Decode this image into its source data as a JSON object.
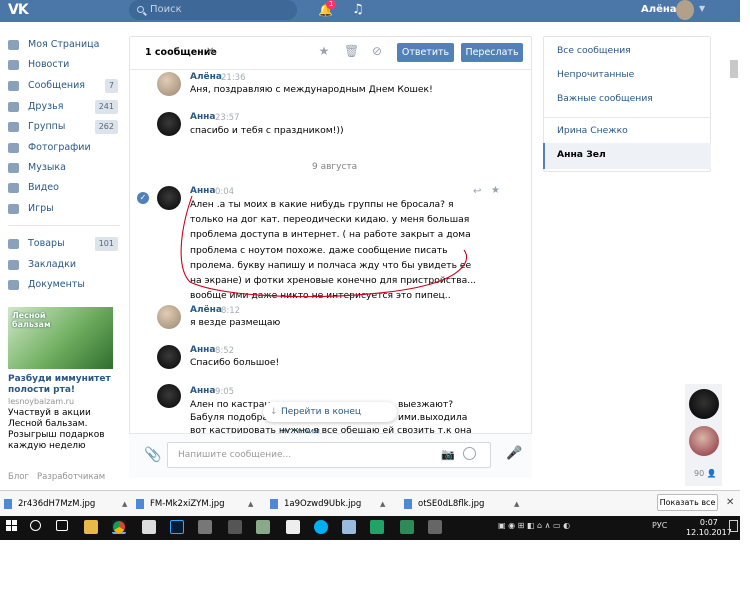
{
  "topbar": {
    "logo": "VK",
    "search_placeholder": "Поиск",
    "notifications_count": "1",
    "user_name": "Алёна"
  },
  "leftnav": {
    "items": [
      {
        "label": "Моя Страница",
        "count": ""
      },
      {
        "label": "Новости",
        "count": ""
      },
      {
        "label": "Сообщения",
        "count": "7"
      },
      {
        "label": "Друзья",
        "count": "241"
      },
      {
        "label": "Группы",
        "count": "262"
      },
      {
        "label": "Фотографии",
        "count": ""
      },
      {
        "label": "Музыка",
        "count": ""
      },
      {
        "label": "Видео",
        "count": ""
      },
      {
        "label": "Игры",
        "count": ""
      },
      {
        "label": "Товары",
        "count": "101"
      },
      {
        "label": "Закладки",
        "count": ""
      },
      {
        "label": "Документы",
        "count": ""
      }
    ],
    "ad": {
      "image_text": "Лесной бальзам",
      "title": "Разбуди иммунитет полости рта!",
      "url": "lesnoybalzam.ru",
      "text": "Участвуй в акции Лесной бальзам. Розыгрыш подарков каждую неделю"
    },
    "footer": [
      "Блог",
      "Разработчикам"
    ]
  },
  "header": {
    "selected_count": "1 сообщение",
    "reply_label": "Ответить",
    "forward_label": "Переслать"
  },
  "messages": [
    {
      "author": "Алёна",
      "time": "21:36",
      "text": "Аня, поздравляю с международным Днем Кошек!"
    },
    {
      "author": "Анна",
      "time": "23:57",
      "text": "спасибо и тебя с праздником!))"
    },
    {
      "author": "Анна",
      "time": "0:04",
      "text": "Ален .а ты моих в какие нибудь группы не бросала? я только на дог кат. переодически кидаю. у меня большая проблема доступа в интернет. ( на работе закрыт а дома проблема с ноутом похоже. даже сообщение писать пролема. букву напишу и полчаса жду что бы увидеть ее на экране) и фотки хреновые конечно для пристройства... вообще ими даже никто не интерисуется это пипец.."
    },
    {
      "author": "Алёна",
      "time": "8:12",
      "text": "я везде размещаю"
    },
    {
      "author": "Анна",
      "time": "8:52",
      "text": "Спасибо большое!"
    },
    {
      "author": "Анна",
      "time": "9:05",
      "line1a": "Ален по кастрац",
      "line1b": "выезжают?",
      "line2a": "Бабуля подобра",
      "line2b": "ими.выходила",
      "line3": "вот кастрировать нужно я все обещаю ей свозить т.к она с"
    }
  ],
  "date_separator": "9 августа",
  "goto_end": "Перейти в конец истории",
  "composer": {
    "placeholder": "Напишите сообщение..."
  },
  "rightpanel": {
    "links": [
      "Все сообщения",
      "Непрочитанные",
      "Важные сообщения",
      "Ирина Снежко"
    ],
    "selected": "Анна Зел"
  },
  "chatstrip": {
    "online_count": "90"
  },
  "downloads": {
    "files": [
      "2r436dH7MzM.jpg",
      "FM-Mk2xiZYM.jpg",
      "1a9Ozwd9Ubk.jpg",
      "otSE0dL8flk.jpg"
    ],
    "show_all": "Показать все"
  },
  "taskbar": {
    "language": "РУС",
    "time": "0:07",
    "date": "12.10.2017"
  },
  "colors": {
    "brand": "#4a76a8",
    "button": "#5181b8",
    "link": "#2a5885",
    "annotation": "#d0021b"
  }
}
